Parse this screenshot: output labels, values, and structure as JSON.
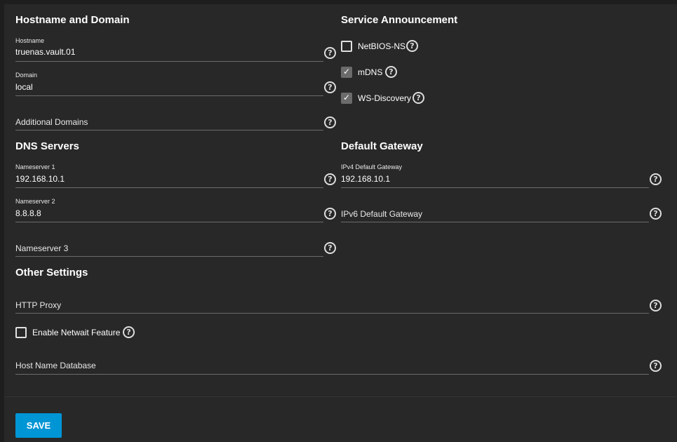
{
  "sections": {
    "hostname_domain": "Hostname and Domain",
    "service_announcement": "Service Announcement",
    "dns_servers": "DNS Servers",
    "default_gateway": "Default Gateway",
    "other_settings": "Other Settings"
  },
  "fields": {
    "hostname": {
      "label": "Hostname",
      "value": "truenas.vault.01"
    },
    "domain": {
      "label": "Domain",
      "value": "local"
    },
    "additional_domains": {
      "placeholder": "Additional Domains"
    },
    "nameserver1": {
      "label": "Nameserver 1",
      "value": "192.168.10.1"
    },
    "nameserver2": {
      "label": "Nameserver 2",
      "value": "8.8.8.8"
    },
    "nameserver3": {
      "placeholder": "Nameserver 3"
    },
    "ipv4_gateway": {
      "label": "IPv4 Default Gateway",
      "value": "192.168.10.1"
    },
    "ipv6_gateway": {
      "placeholder": "IPv6 Default Gateway"
    },
    "http_proxy": {
      "placeholder": "HTTP Proxy"
    },
    "host_name_database": {
      "placeholder": "Host Name Database"
    }
  },
  "checkboxes": {
    "netbios_ns": {
      "label": "NetBIOS-NS",
      "checked": false
    },
    "mdns": {
      "label": "mDNS",
      "checked": true
    },
    "ws_discovery": {
      "label": "WS-Discovery",
      "checked": true
    },
    "netwait": {
      "label": "Enable Netwait Feature",
      "checked": false
    }
  },
  "icons": {
    "help": "help-circle-icon",
    "check": "checkmark-icon"
  },
  "colors": {
    "background": "#282828",
    "accent": "#0095d5"
  },
  "footer": {
    "save_label": "SAVE"
  }
}
